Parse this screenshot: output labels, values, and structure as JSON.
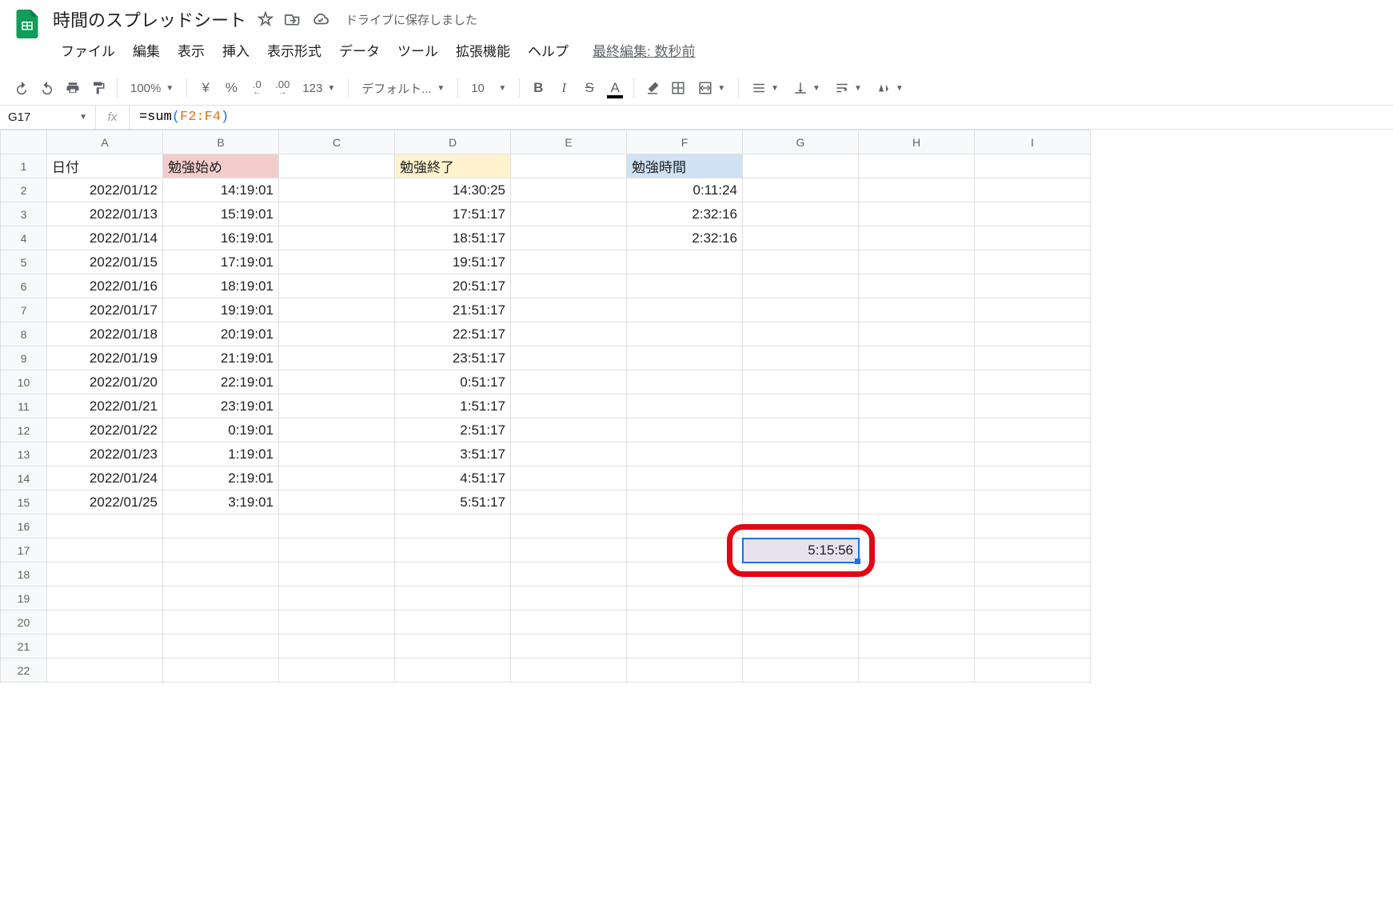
{
  "doc": {
    "title": "時間のスプレッドシート",
    "save_status": "ドライブに保存しました",
    "last_edit": "最終編集: 数秒前"
  },
  "menus": [
    "ファイル",
    "編集",
    "表示",
    "挿入",
    "表示形式",
    "データ",
    "ツール",
    "拡張機能",
    "ヘルプ"
  ],
  "toolbar": {
    "zoom": "100%",
    "currency": "¥",
    "percent": "%",
    "dec_less": ".0",
    "dec_more": ".00",
    "format_more": "123",
    "font": "デフォルト...",
    "font_size": "10"
  },
  "formula_bar": {
    "cell_ref": "G17",
    "fx": "fx",
    "formula_prefix": "=sum",
    "formula_paren_open": "(",
    "formula_range": "F2:F4",
    "formula_paren_close": ")"
  },
  "columns": [
    "A",
    "B",
    "C",
    "D",
    "E",
    "F",
    "G",
    "H",
    "I"
  ],
  "header_row": {
    "A": "日付",
    "B": "勉強始め",
    "D": "勉強終了",
    "F": "勉強時間"
  },
  "rows": [
    {
      "A": "2022/01/12",
      "B": "14:19:01",
      "D": "14:30:25",
      "F": "0:11:24"
    },
    {
      "A": "2022/01/13",
      "B": "15:19:01",
      "D": "17:51:17",
      "F": "2:32:16"
    },
    {
      "A": "2022/01/14",
      "B": "16:19:01",
      "D": "18:51:17",
      "F": "2:32:16"
    },
    {
      "A": "2022/01/15",
      "B": "17:19:01",
      "D": "19:51:17",
      "F": ""
    },
    {
      "A": "2022/01/16",
      "B": "18:19:01",
      "D": "20:51:17",
      "F": ""
    },
    {
      "A": "2022/01/17",
      "B": "19:19:01",
      "D": "21:51:17",
      "F": ""
    },
    {
      "A": "2022/01/18",
      "B": "20:19:01",
      "D": "22:51:17",
      "F": ""
    },
    {
      "A": "2022/01/19",
      "B": "21:19:01",
      "D": "23:51:17",
      "F": ""
    },
    {
      "A": "2022/01/20",
      "B": "22:19:01",
      "D": "0:51:17",
      "F": ""
    },
    {
      "A": "2022/01/21",
      "B": "23:19:01",
      "D": "1:51:17",
      "F": ""
    },
    {
      "A": "2022/01/22",
      "B": "0:19:01",
      "D": "2:51:17",
      "F": ""
    },
    {
      "A": "2022/01/23",
      "B": "1:19:01",
      "D": "3:51:17",
      "F": ""
    },
    {
      "A": "2022/01/24",
      "B": "2:19:01",
      "D": "4:51:17",
      "F": ""
    },
    {
      "A": "2022/01/25",
      "B": "3:19:01",
      "D": "5:51:17",
      "F": ""
    }
  ],
  "selected": {
    "row": 17,
    "col": "G",
    "value": "5:15:56"
  },
  "row_count": 22
}
